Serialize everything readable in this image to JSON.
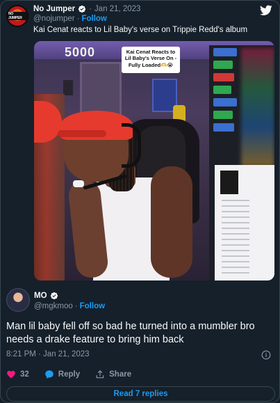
{
  "quoted_tweet": {
    "avatar_text": "NO JUMPER",
    "name": "No Jumper",
    "separator": "·",
    "date": "Jan 21, 2023",
    "handle": "@nojumper",
    "follow_separator": "·",
    "follow_label": "Follow",
    "text": "Kai Cenat reacts to Lil Baby's verse on Trippie Redd's album",
    "media": {
      "overlay_text": "5000",
      "caption": "Kai Cenat Reacts to Lil Baby's Verse On - Fully Loaded🫶😭"
    }
  },
  "main_tweet": {
    "name": "MO",
    "handle": "@mgkmoo",
    "follow_separator": "·",
    "follow_label": "Follow",
    "text": "Man lil baby fell off so bad he turned into a mumbler bro needs a drake feature to bring him back",
    "timestamp": "8:21 PM · Jan 21, 2023",
    "like_count": "32",
    "reply_label": "Reply",
    "share_label": "Share",
    "read_replies_label": "Read 7 replies"
  },
  "colors": {
    "background": "#15202b",
    "accent": "#1d9bf0",
    "like": "#f91880",
    "muted": "#8b98a5"
  }
}
